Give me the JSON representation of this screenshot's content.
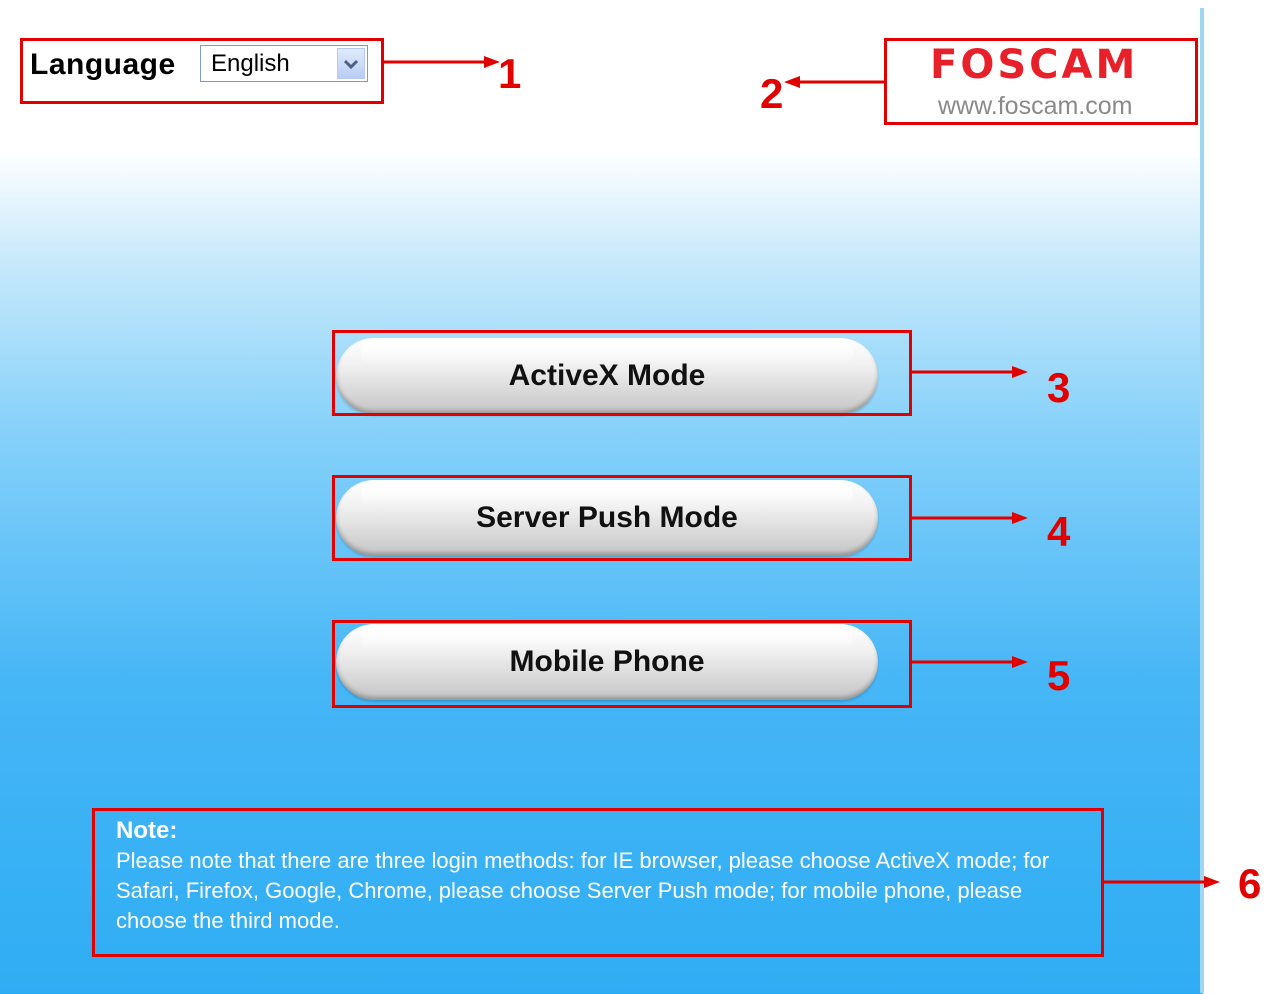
{
  "language": {
    "label": "Language",
    "selected": "English"
  },
  "logo": {
    "brand": "FOSCAM",
    "url": "www.foscam.com"
  },
  "modes": [
    {
      "label": "ActiveX Mode"
    },
    {
      "label": "Server Push Mode"
    },
    {
      "label": "Mobile Phone"
    }
  ],
  "note": {
    "title": "Note:",
    "text": "Please note that there are three login methods: for IE browser, please choose ActiveX mode; for Safari, Firefox, Google, Chrome, please choose Server Push mode; for mobile phone, please choose the third mode."
  },
  "annotations": [
    "1",
    "2",
    "3",
    "4",
    "5",
    "6"
  ],
  "colors": {
    "annotation_red": "#e00000",
    "brand_red": "#e8202a",
    "note_text": "#ffffff"
  }
}
